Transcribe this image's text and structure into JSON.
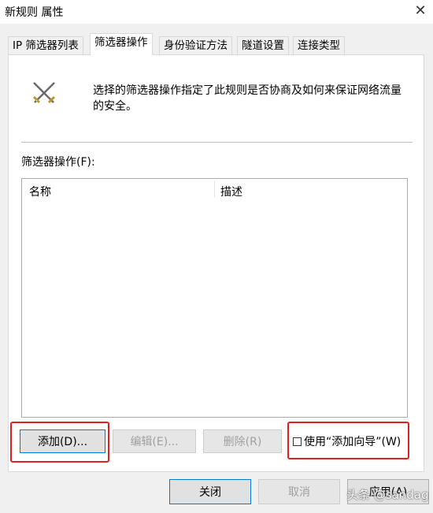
{
  "window": {
    "title": "新规则 属性",
    "close_glyph": "✕"
  },
  "tabs": [
    {
      "label": "IP 筛选器列表",
      "active": false
    },
    {
      "label": "筛选器操作",
      "active": true
    },
    {
      "label": "身份验证方法",
      "active": false
    },
    {
      "label": "隧道设置",
      "active": false
    },
    {
      "label": "连接类型",
      "active": false
    }
  ],
  "panel": {
    "icon": "crossed-swords-icon",
    "description_line1": "选择的筛选器操作指定了此规则是否协商及如何来保证网络流量",
    "description_line2": "的安全。",
    "list_label": "筛选器操作(F):",
    "columns": [
      "名称",
      "描述"
    ],
    "rows": []
  },
  "buttons": {
    "add": "添加(D)...",
    "edit": "编辑(E)...",
    "remove": "删除(R)",
    "use_wizard": "使用“添加向导”(W)"
  },
  "footer": {
    "close": "关闭",
    "cancel": "取消",
    "apply": "应用(A)"
  },
  "watermark": "头条 @sandag",
  "colors": {
    "highlight": "#e02020",
    "accent": "#0078d7"
  }
}
